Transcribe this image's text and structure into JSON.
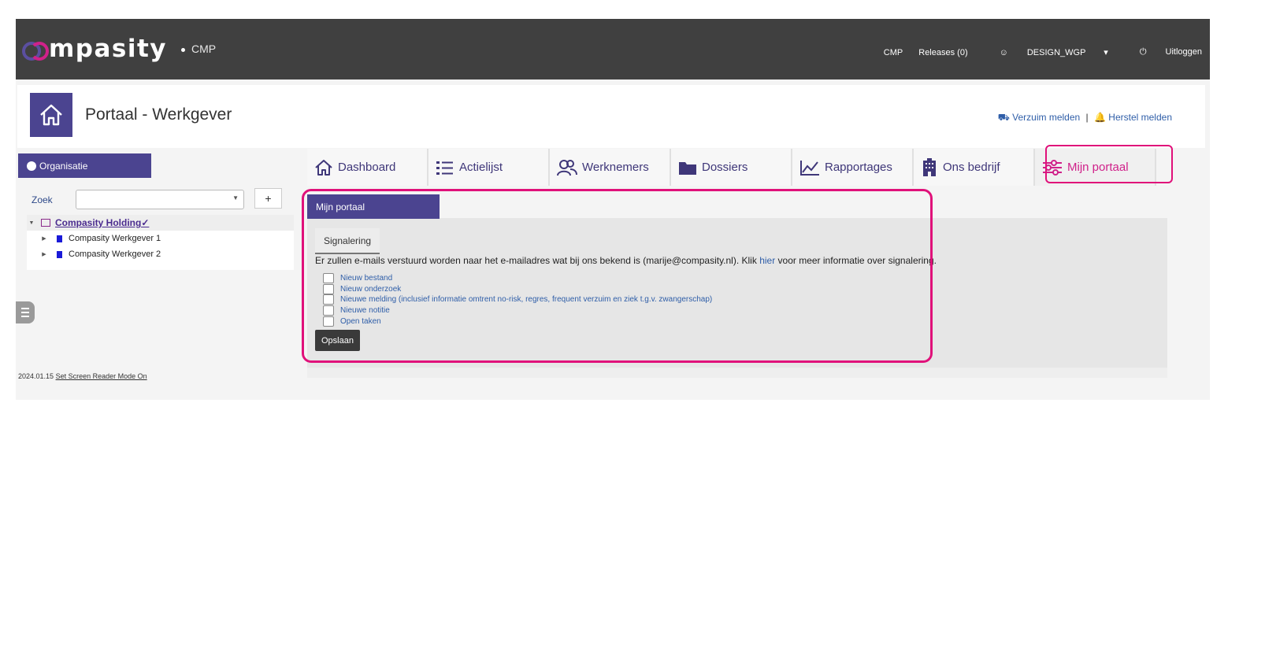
{
  "brand": {
    "logo_text": "mpasity",
    "product": "CMP"
  },
  "topnav": {
    "cmp": "CMP",
    "releases": "Releases (0)",
    "user": "DESIGN_WGP",
    "logout": "Uitloggen"
  },
  "header": {
    "title": "Portaal - Werkgever",
    "verzuim": "Verzuim melden",
    "separator": "|",
    "herstel": "Herstel melden"
  },
  "sidebar": {
    "tab_label": "Organisatie",
    "search_label": "Zoek",
    "add_label": "+",
    "tree": {
      "root": "Compasity Holding✓",
      "children": [
        "Compasity Werkgever 1",
        "Compasity Werkgever 2"
      ]
    }
  },
  "nav": {
    "tabs": [
      {
        "label": "Dashboard",
        "icon": "home-icon"
      },
      {
        "label": "Actielijst",
        "icon": "list-icon"
      },
      {
        "label": "Werknemers",
        "icon": "users-icon"
      },
      {
        "label": "Dossiers",
        "icon": "folder-icon"
      },
      {
        "label": "Rapportages",
        "icon": "chart-icon"
      },
      {
        "label": "Ons bedrijf",
        "icon": "building-icon"
      },
      {
        "label": "Mijn portaal",
        "icon": "sliders-icon",
        "active": true
      }
    ]
  },
  "content": {
    "panel_title": "Mijn portaal",
    "sub_tab": "Signalering",
    "info_pre": "Er zullen e-mails verstuurd worden naar het e-mailadres wat bij ons bekend is (marije@compasity.nl). Klik ",
    "info_link": "hier",
    "info_post": " voor meer informatie over signalering.",
    "checkboxes": [
      "Nieuw bestand",
      "Nieuw onderzoek",
      "Nieuwe melding (inclusief informatie omtrent no-risk, regres, frequent verzuim en ziek t.g.v. zwangerschap)",
      "Nieuwe notitie",
      "Open taken"
    ],
    "save_label": "Opslaan"
  },
  "footer": {
    "version": "2024.01.15",
    "screen_reader": "Set Screen Reader Mode On"
  },
  "colors": {
    "primary": "#4b4490",
    "accent": "#d0218a",
    "highlight": "#e0117a",
    "topbar": "#404040"
  }
}
